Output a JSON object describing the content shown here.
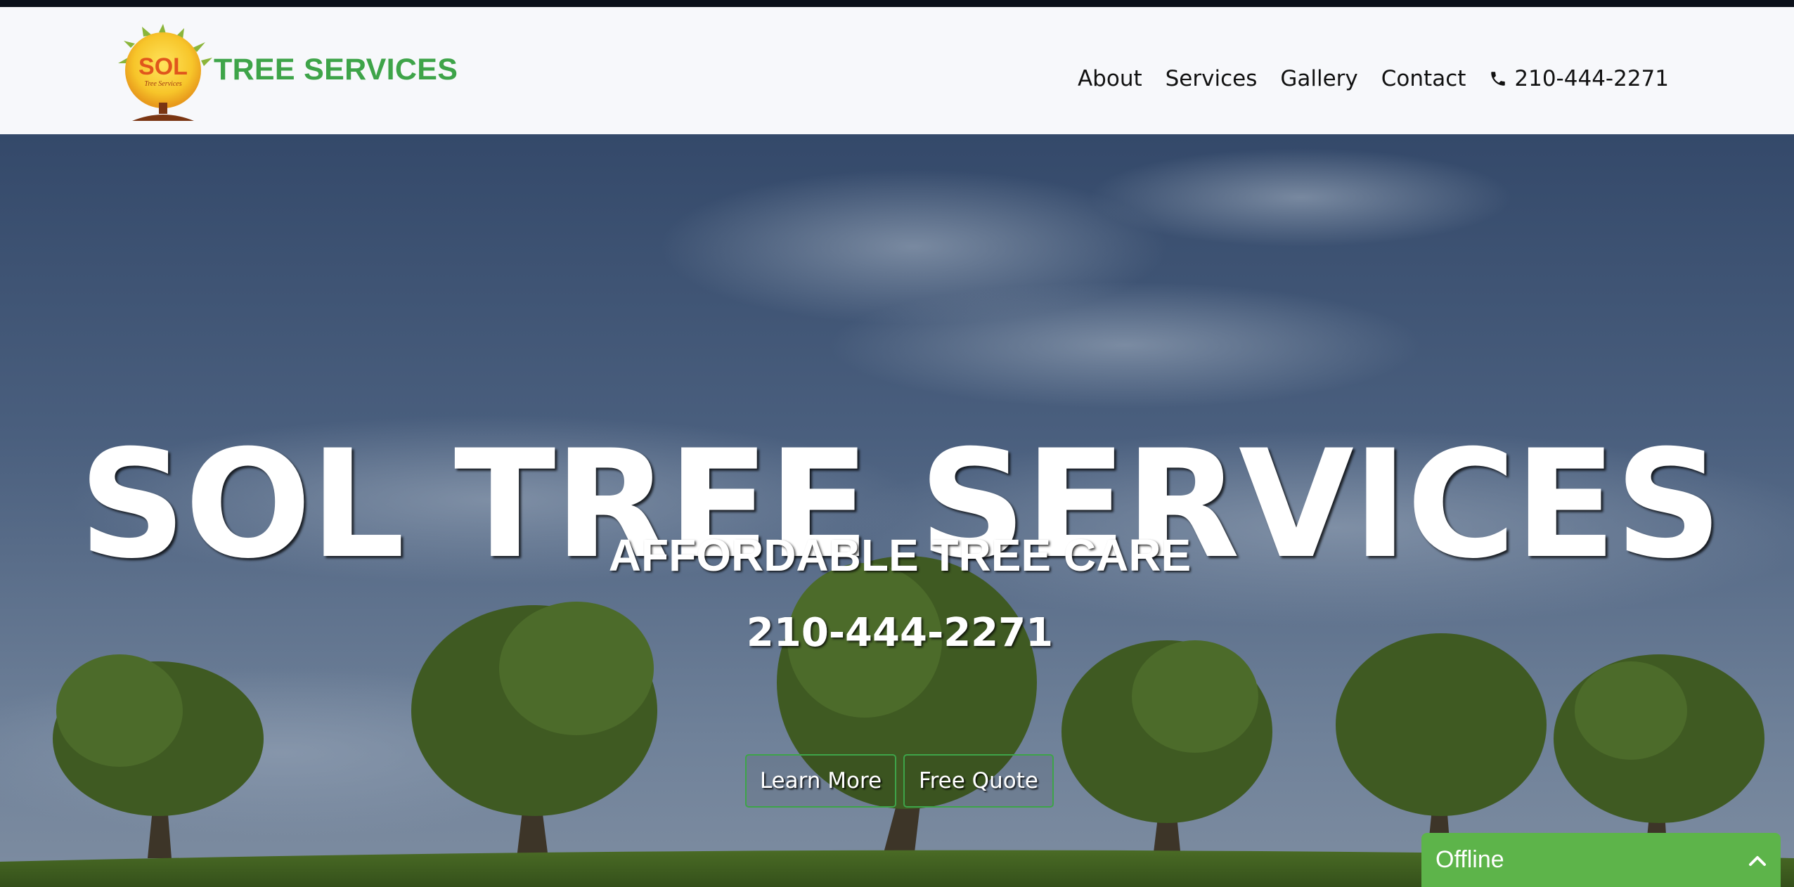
{
  "brand": {
    "name": "TREE SERVICES",
    "logo_text": "SOL",
    "logo_subtext": "Tree Services"
  },
  "nav": {
    "items": [
      {
        "label": "About"
      },
      {
        "label": "Services"
      },
      {
        "label": "Gallery"
      },
      {
        "label": "Contact"
      }
    ],
    "phone": "210-444-2271",
    "phone_icon": "phone-icon"
  },
  "hero": {
    "title": "SOL TREE SERVICES",
    "subtitle": "AFFORDABLE TREE CARE",
    "phone": "210-444-2271",
    "buttons": {
      "learn_more": "Learn More",
      "free_quote": "Free Quote"
    }
  },
  "chat": {
    "status": "Offline",
    "toggle_icon": "chevron-up-icon"
  },
  "colors": {
    "brand_green": "#3ea449",
    "navbar_bg": "#f7f8fb",
    "chat_green": "#5db44a",
    "sky_overlay": "#2d4060"
  }
}
